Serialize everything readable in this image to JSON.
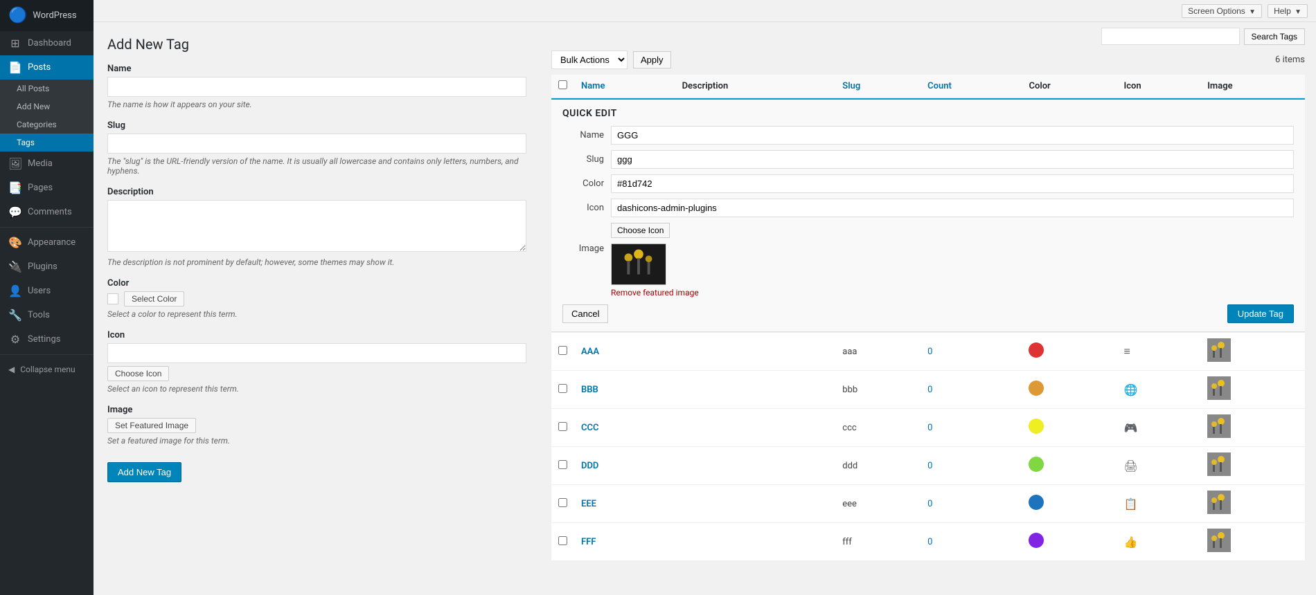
{
  "topbar": {
    "screen_options_label": "Screen Options",
    "help_label": "Help"
  },
  "sidebar": {
    "brand_label": "WordPress",
    "items": [
      {
        "id": "dashboard",
        "label": "Dashboard",
        "icon": "⊞"
      },
      {
        "id": "posts",
        "label": "Posts",
        "icon": "📄",
        "active": true,
        "subitems": [
          {
            "id": "all-posts",
            "label": "All Posts"
          },
          {
            "id": "add-new",
            "label": "Add New"
          },
          {
            "id": "categories",
            "label": "Categories"
          },
          {
            "id": "tags",
            "label": "Tags",
            "active": true
          }
        ]
      },
      {
        "id": "media",
        "label": "Media",
        "icon": "🖼"
      },
      {
        "id": "pages",
        "label": "Pages",
        "icon": "📑"
      },
      {
        "id": "comments",
        "label": "Comments",
        "icon": "💬"
      },
      {
        "id": "appearance",
        "label": "Appearance",
        "icon": "🎨"
      },
      {
        "id": "plugins",
        "label": "Plugins",
        "icon": "🔌"
      },
      {
        "id": "users",
        "label": "Users",
        "icon": "👤"
      },
      {
        "id": "tools",
        "label": "Tools",
        "icon": "🔧"
      },
      {
        "id": "settings",
        "label": "Settings",
        "icon": "⚙"
      }
    ],
    "collapse_label": "Collapse menu"
  },
  "page_title": "Add New Tag",
  "form": {
    "name_label": "Name",
    "name_placeholder": "",
    "name_hint": "The name is how it appears on your site.",
    "slug_label": "Slug",
    "slug_placeholder": "",
    "slug_hint": "The \"slug\" is the URL-friendly version of the name. It is usually all lowercase and contains only letters, numbers, and hyphens.",
    "description_label": "Description",
    "description_placeholder": "",
    "description_hint": "The description is not prominent by default; however, some themes may show it.",
    "color_label": "Color",
    "color_hint": "Select a color to represent this term.",
    "select_color_btn": "Select Color",
    "icon_label": "Icon",
    "icon_placeholder": "",
    "icon_hint": "Select an icon to represent this term.",
    "choose_icon_btn": "Choose Icon",
    "image_label": "Image",
    "set_featured_image_btn": "Set Featured Image",
    "set_featured_image_hint": "Set a featured image for this term.",
    "add_new_btn": "Add New Tag"
  },
  "search": {
    "placeholder": "",
    "btn_label": "Search Tags"
  },
  "bulk_actions": {
    "select_label": "Bulk Actions",
    "apply_btn": "Apply",
    "items_count": "6 items"
  },
  "table": {
    "columns": [
      "Name",
      "Description",
      "Slug",
      "Count",
      "Color",
      "Icon",
      "Image"
    ],
    "quick_edit": {
      "title": "QUICK EDIT",
      "name_label": "Name",
      "name_value": "GGG",
      "slug_label": "Slug",
      "slug_value": "ggg",
      "color_label": "Color",
      "color_value": "#81d742",
      "icon_label": "Icon",
      "icon_value": "dashicons-admin-plugins",
      "choose_icon_btn": "Choose Icon",
      "image_label": "Image",
      "remove_image_label": "Remove featured image",
      "cancel_btn": "Cancel",
      "update_btn": "Update Tag"
    },
    "rows": [
      {
        "id": "aaa",
        "name": "AAA",
        "slug": "aaa",
        "count": "0",
        "color": "#dd3333",
        "color_name": "red",
        "icon": "≡",
        "has_image": true
      },
      {
        "id": "bbb",
        "name": "BBB",
        "slug": "bbb",
        "count": "0",
        "color": "#dd9933",
        "color_name": "orange",
        "icon": "🌐",
        "has_image": true
      },
      {
        "id": "ccc",
        "name": "CCC",
        "slug": "ccc",
        "count": "0",
        "color": "#eeee22",
        "color_name": "yellow",
        "icon": "🎮",
        "has_image": true
      },
      {
        "id": "ddd",
        "name": "DDD",
        "slug": "ddd",
        "count": "0",
        "color": "#81d742",
        "color_name": "green",
        "icon": "🖨",
        "has_image": true
      },
      {
        "id": "eee",
        "name": "EEE",
        "slug": "eee",
        "count": "0",
        "color": "#1e73be",
        "color_name": "blue",
        "icon": "📋",
        "has_image": true
      },
      {
        "id": "fff",
        "name": "FFF",
        "slug": "fff",
        "count": "0",
        "color": "#8224e3",
        "color_name": "purple",
        "icon": "👍",
        "has_image": true
      }
    ]
  }
}
